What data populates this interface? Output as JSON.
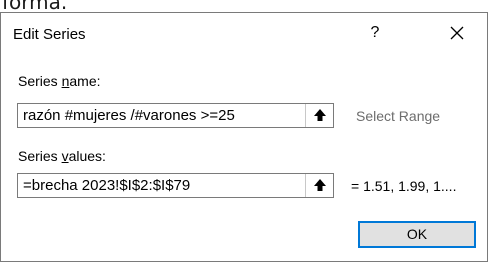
{
  "background": {
    "partial_text": "forma."
  },
  "dialog": {
    "title": "Edit Series",
    "help_label": "?",
    "series_name": {
      "label_prefix": "Series ",
      "label_underlined": "n",
      "label_suffix": "ame:",
      "value": "razón #mujeres /#varones >=25",
      "side_text": "Select Range"
    },
    "series_values": {
      "label_prefix": "Series ",
      "label_underlined": "v",
      "label_suffix": "alues:",
      "value": "=brecha 2023!$I$2:$I$79",
      "side_text": "= 1.51, 1.99, 1...."
    },
    "ok_label": "OK"
  },
  "colors": {
    "border": "#7a7a7a",
    "ok_border": "#0078d7",
    "ok_fill": "#e1e1e1",
    "muted_text": "#6d6d6d"
  },
  "icons": {
    "close": "close-icon",
    "collapse": "collapse-dialog-icon"
  }
}
